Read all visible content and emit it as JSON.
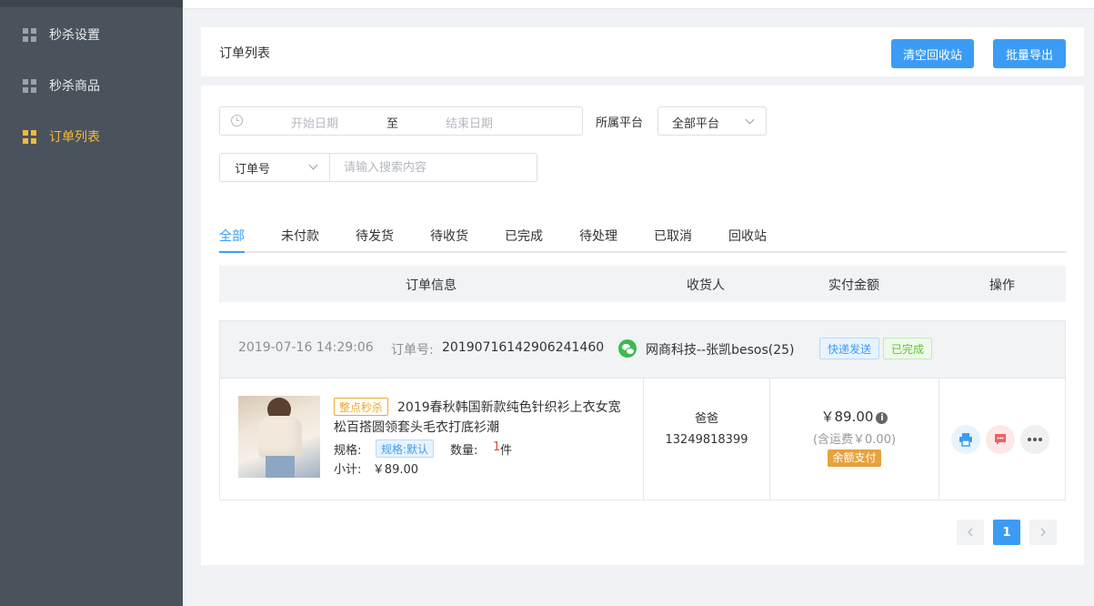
{
  "sidebar": {
    "items": [
      {
        "label": "秒杀设置",
        "active": false
      },
      {
        "label": "秒杀商品",
        "active": false
      },
      {
        "label": "订单列表",
        "active": true
      }
    ]
  },
  "header": {
    "title": "订单列表",
    "clear_recycle_label": "清空回收站",
    "batch_export_label": "批量导出"
  },
  "filters": {
    "start_date_placeholder": "开始日期",
    "range_separator": "至",
    "end_date_placeholder": "结束日期",
    "platform_label": "所属平台",
    "platform_value": "全部平台",
    "search_type_value": "订单号",
    "search_placeholder": "请输入搜索内容"
  },
  "tabs": [
    "全部",
    "未付款",
    "待发货",
    "待收货",
    "已完成",
    "待处理",
    "已取消",
    "回收站"
  ],
  "active_tab": "全部",
  "table_headers": {
    "order_info": "订单信息",
    "receiver": "收货人",
    "paid_amount": "实付金额",
    "actions": "操作"
  },
  "order": {
    "time": "2019-07-16 14:29:06",
    "order_no_label": "订单号:",
    "order_no": "20190716142906241460",
    "shop": "网商科技--张凯besos(25)",
    "delivery_tag": "快递发送",
    "status_tag": "已完成",
    "product": {
      "flash_tag": "整点秒杀",
      "name": "2019春秋韩国新款纯色针织衫上衣女宽松百搭圆领套头毛衣打底衫潮",
      "spec_label": "规格:",
      "spec_value": "规格:默认",
      "qty_label": "数量:",
      "qty": "1",
      "qty_unit": "件",
      "subtotal_label": "小计:",
      "subtotal": "￥89.00"
    },
    "receiver_name": "爸爸",
    "receiver_phone": "13249818399",
    "amount": "￥89.00",
    "shipping": "(含运费￥0.00)",
    "pay_method": "余额支付"
  },
  "pagination": {
    "current": "1"
  },
  "colors": {
    "primary": "#3c9cf5",
    "sidebar_bg": "#4a535b",
    "active_menu": "#f5b83d",
    "danger": "#e6453c",
    "warning": "#e6a23c"
  }
}
